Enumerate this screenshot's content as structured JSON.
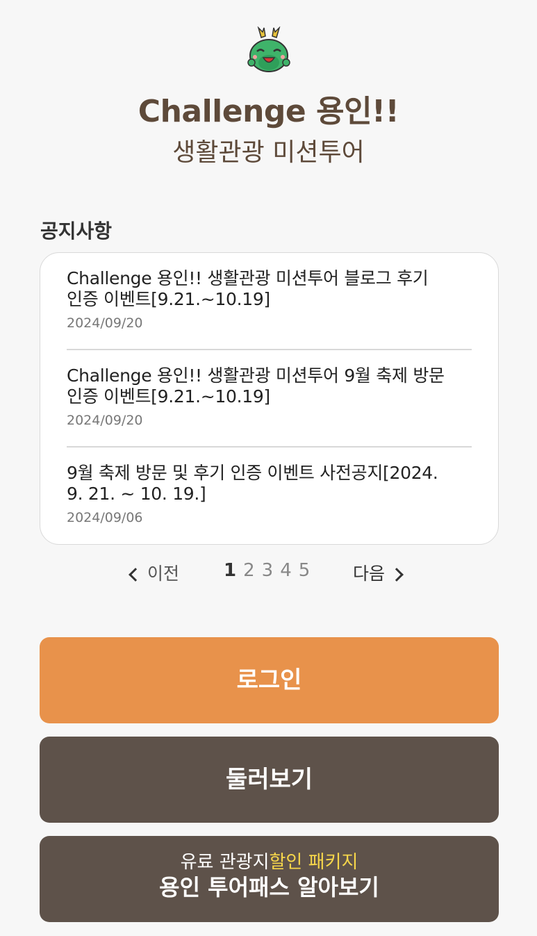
{
  "header": {
    "title": "Challenge 용인!!",
    "subtitle": "생활관광 미션투어"
  },
  "notices": {
    "heading": "공지사항",
    "items": [
      {
        "title_line1": "Challenge 용인!! 생활관광 미션투어 블로그 후기",
        "title_line2": "인증 이벤트[9.21.~10.19]",
        "date": "2024/09/20"
      },
      {
        "title_line1": "Challenge 용인!! 생활관광 미션투어 9월 축제 방문",
        "title_line2": "인증 이벤트[9.21.~10.19]",
        "date": "2024/09/20"
      },
      {
        "title_line1": "9월 축제 방문 및 후기 인증 이벤트 사전공지[2024.",
        "title_line2": "9. 21. ~ 10. 19.]",
        "date": "2024/09/06"
      }
    ]
  },
  "pagination": {
    "prev_label": "이전",
    "next_label": "다음",
    "pages": [
      "1",
      "2",
      "3",
      "4",
      "5"
    ],
    "current_page": "1"
  },
  "buttons": {
    "login": "로그인",
    "browse": "둘러보기",
    "pass_line1_normal": "유료 관광지",
    "pass_line1_highlight": "할인 패키지",
    "pass_line2": "용인 투어패스 알아보기"
  },
  "colors": {
    "accent_orange": "#e8924b",
    "brown": "#5e524a",
    "title_brown": "#5e4a3a",
    "highlight_yellow": "#f6d64a"
  },
  "icons": {
    "mascot": "green-dragon-mascot"
  }
}
